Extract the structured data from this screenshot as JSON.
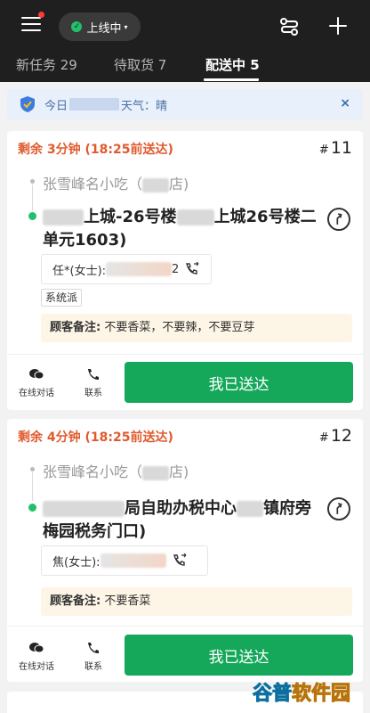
{
  "status": {
    "label": "上线中"
  },
  "tabs": [
    {
      "label": "新任务 29",
      "active": false
    },
    {
      "label": "待取货 7",
      "active": false
    },
    {
      "label": "配送中 5",
      "active": true
    }
  ],
  "notice": {
    "prefix": "今日",
    "suffix": "天气：晴",
    "close": "×"
  },
  "orders": [
    {
      "remain": "剩余 3分钟 (18:25前送达)",
      "number": "11",
      "shop_name": "张雪峰名小吃（",
      "shop_suffix": "店)",
      "addr_part1": "上城-26号楼",
      "addr_part2": "上城26号楼二单元1603)",
      "contact": "任*(女士):",
      "phone_tail": "2",
      "tag": "系统派",
      "note_label": "顾客备注:",
      "note_text": "不要香菜，不要辣，不要豆芽",
      "chat_label": "在线对话",
      "contact_label": "联系",
      "deliver_label": "我已送达"
    },
    {
      "remain": "剩余 4分钟 (18:25前送达)",
      "number": "12",
      "shop_name": "张雪峰名小吃（",
      "shop_suffix": "店)",
      "addr_part1": "局自助办税中心",
      "addr_part2": "镇府旁梅园税务门口)",
      "contact": "焦(女士):",
      "tag": "",
      "note_label": "顾客备注:",
      "note_text": "不要香菜",
      "chat_label": "在线对话",
      "contact_label": "联系",
      "deliver_label": "我已送达"
    }
  ],
  "watermark": {
    "part1": "谷普",
    "part2": "软件园"
  },
  "colors": {
    "accent_green": "#16a85a",
    "urgent_orange": "#e05a2e",
    "topbar": "#1f1f1f"
  }
}
